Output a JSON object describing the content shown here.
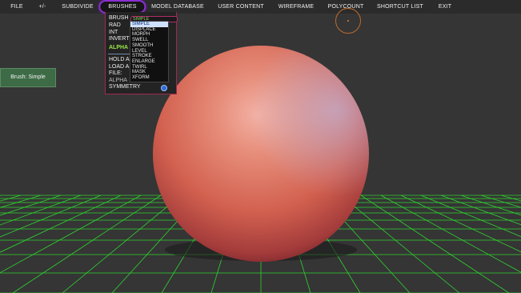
{
  "menu": {
    "file": "FILE",
    "plusminus": "+/-",
    "subdivide": "SUBDIVIDE",
    "brushes": "BRUSHES",
    "model_database": "MODEL DATABASE",
    "user_content": "USER CONTENT",
    "wireframe": "WIREFRAME",
    "polycount": "POLYCOUNT",
    "shortcut_list": "SHORTCUT LIST",
    "exit": "EXIT"
  },
  "brush_panel": {
    "brush_label": "BRUSH",
    "rad_label": "RAD",
    "int_label": "INT",
    "invert_label": "INVERT",
    "alpha_header": "ALPHA",
    "hold_label": "HOLD A",
    "load_label": "LOAD A",
    "file_label": "FILE:",
    "alpha_label": "ALPHA",
    "symmetry_label": "SYMMETRY",
    "brush_value": "SIMPLE",
    "dropdown_options": [
      "SIMPLE",
      "DISPLACE",
      "MORPH",
      "SWELL",
      "SMOOTH",
      "LEVEL",
      "STROKE",
      "ENLARGE",
      "TWIRL",
      "MASK",
      "XFORM"
    ],
    "selected_option": "SIMPLE"
  },
  "side_button": {
    "label": "Brush: Simple"
  },
  "colors": {
    "background": "#353535",
    "menubar": "#2b2b2b",
    "active_menu_border": "#8a2fd0",
    "grid": "#2fd52f",
    "sphere_highlight": "#f0a89c",
    "sphere_base": "#d96a58",
    "sphere_shadow": "#6e1e24",
    "button_green": "#3d6b46",
    "cursor_ring": "#c06a2c"
  },
  "icons": {
    "cursor": "brush-cursor-ring-icon",
    "symmetry": "radio-toggle-icon"
  }
}
